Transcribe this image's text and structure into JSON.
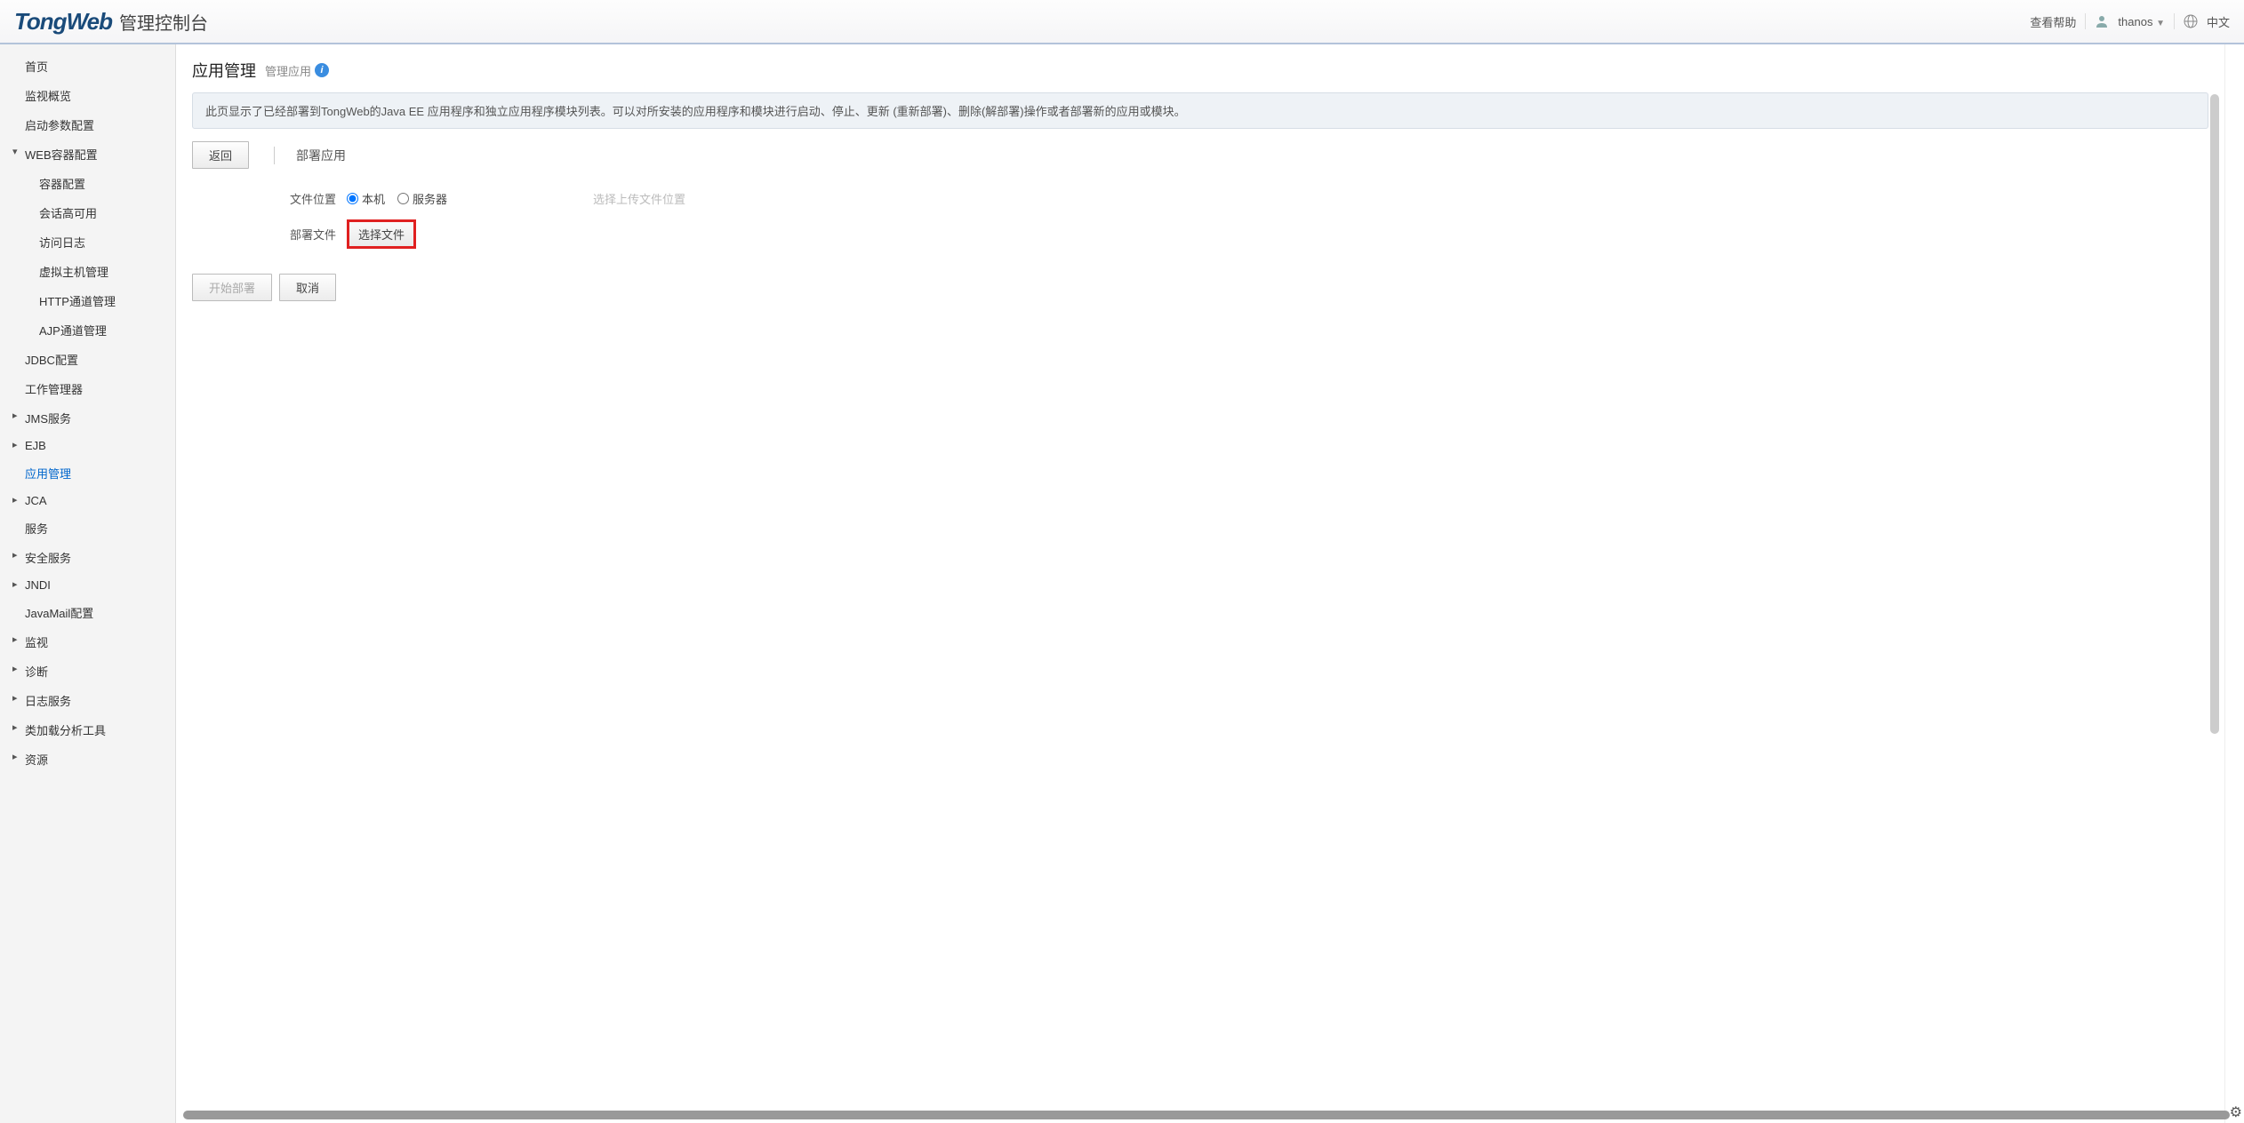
{
  "header": {
    "logo_brand": "TongWeb",
    "logo_subtitle": "管理控制台",
    "help_link": "查看帮助",
    "username": "thanos",
    "language": "中文"
  },
  "sidebar": {
    "items": [
      {
        "label": "首页",
        "level": 1
      },
      {
        "label": "监视概览",
        "level": 1
      },
      {
        "label": "启动参数配置",
        "level": 1
      },
      {
        "label": "WEB容器配置",
        "level": 1,
        "expanded": true
      },
      {
        "label": "容器配置",
        "level": 2
      },
      {
        "label": "会话高可用",
        "level": 2
      },
      {
        "label": "访问日志",
        "level": 2
      },
      {
        "label": "虚拟主机管理",
        "level": 2
      },
      {
        "label": "HTTP通道管理",
        "level": 2
      },
      {
        "label": "AJP通道管理",
        "level": 2
      },
      {
        "label": "JDBC配置",
        "level": 1
      },
      {
        "label": "工作管理器",
        "level": 1
      },
      {
        "label": "JMS服务",
        "level": 1,
        "expandable": true
      },
      {
        "label": "EJB",
        "level": 1,
        "expandable": true
      },
      {
        "label": "应用管理",
        "level": 1,
        "active": true
      },
      {
        "label": "JCA",
        "level": 1,
        "expandable": true
      },
      {
        "label": "服务",
        "level": 1
      },
      {
        "label": "安全服务",
        "level": 1,
        "expandable": true
      },
      {
        "label": "JNDI",
        "level": 1,
        "expandable": true
      },
      {
        "label": "JavaMail配置",
        "level": 1
      },
      {
        "label": "监视",
        "level": 1,
        "expandable": true
      },
      {
        "label": "诊断",
        "level": 1,
        "expandable": true
      },
      {
        "label": "日志服务",
        "level": 1,
        "expandable": true
      },
      {
        "label": "类加载分析工具",
        "level": 1,
        "expandable": true
      },
      {
        "label": "资源",
        "level": 1,
        "expandable": true
      }
    ]
  },
  "page": {
    "title": "应用管理",
    "subtitle": "管理应用",
    "info_banner": "此页显示了已经部署到TongWeb的Java EE 应用程序和独立应用程序模块列表。可以对所安装的应用程序和模块进行启动、停止、更新 (重新部署)、删除(解部署)操作或者部署新的应用或模块。",
    "back_btn": "返回",
    "deploy_tab": "部署应用",
    "form": {
      "file_location_label": "文件位置",
      "radio_local": "本机",
      "radio_server": "服务器",
      "upload_hint": "选择上传文件位置",
      "deploy_file_label": "部署文件",
      "choose_file_btn": "选择文件"
    },
    "start_deploy_btn": "开始部署",
    "cancel_btn": "取消"
  }
}
